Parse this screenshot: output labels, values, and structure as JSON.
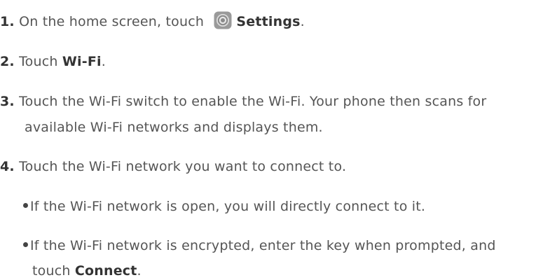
{
  "steps": [
    {
      "number": "1.",
      "pre": "On the home screen, touch",
      "bold": "Settings",
      "post": ".",
      "icon": "settings-gear-icon"
    },
    {
      "number": "2.",
      "pre": "Touch ",
      "bold": "Wi-Fi",
      "post": "."
    },
    {
      "number": "3.",
      "line1": "Touch the Wi-Fi switch to enable the Wi-Fi. Your phone then scans for",
      "line2": "available Wi-Fi networks and displays them."
    },
    {
      "number": "4.",
      "text": "Touch the Wi-Fi network you want to connect to."
    }
  ],
  "bullets": [
    {
      "text": "If the Wi-Fi network is open, you will directly connect to it."
    },
    {
      "line1": "If the Wi-Fi network is encrypted, enter the key when prompted, and",
      "line2_pre": "touch ",
      "line2_bold": "Connect",
      "line2_post": "."
    }
  ],
  "colors": {
    "text": "#555555",
    "bold": "#333333",
    "icon_gray": "#8a8a8a"
  }
}
